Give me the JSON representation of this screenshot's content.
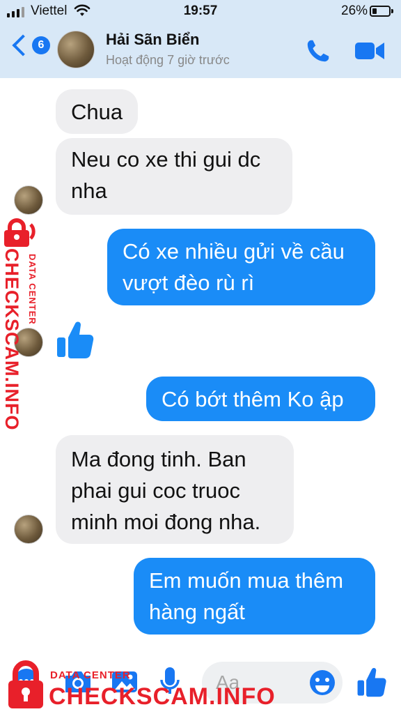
{
  "status_bar": {
    "carrier": "Viettel",
    "time": "19:57",
    "battery": "26%",
    "battery_level": 0.26
  },
  "header": {
    "back_count": "6",
    "contact_name": "Hải Sãn Biển",
    "contact_status": "Hoạt động 7 giờ trước",
    "call_icon": "phone-icon",
    "video_icon": "video-camera-icon"
  },
  "messages": [
    {
      "side": "in",
      "text": "Chua"
    },
    {
      "side": "in",
      "text": "Neu co xe thi gui dc nha"
    },
    {
      "side": "out",
      "text": "Có xe nhiều gửi về cầu vượt đèo rù rì"
    },
    {
      "side": "in",
      "type": "like-sticker",
      "icon": "thumbs-up-icon"
    },
    {
      "side": "out",
      "text": "Có bớt thêm Ko ập"
    },
    {
      "side": "in",
      "text": "Ma đong tinh. Ban phai gui coc truoc minh moi đong nha."
    },
    {
      "side": "out",
      "text": "Em muốn mua thêm hàng ngất"
    }
  ],
  "composer": {
    "placeholder": "Aa",
    "icons": [
      "menu-icon",
      "camera-icon",
      "photo-icon",
      "microphone-icon",
      "emoji-icon",
      "thumbs-up-icon"
    ]
  },
  "watermark": {
    "brand": "CHECKSCAM.INFO",
    "subtitle": "DATA CENTER",
    "color": "#e8202a"
  },
  "colors": {
    "accent": "#1877f2",
    "outgoing_bubble": "#1a8cf7",
    "incoming_bubble": "#eeeef0",
    "header_bg": "#d8e8f7"
  }
}
